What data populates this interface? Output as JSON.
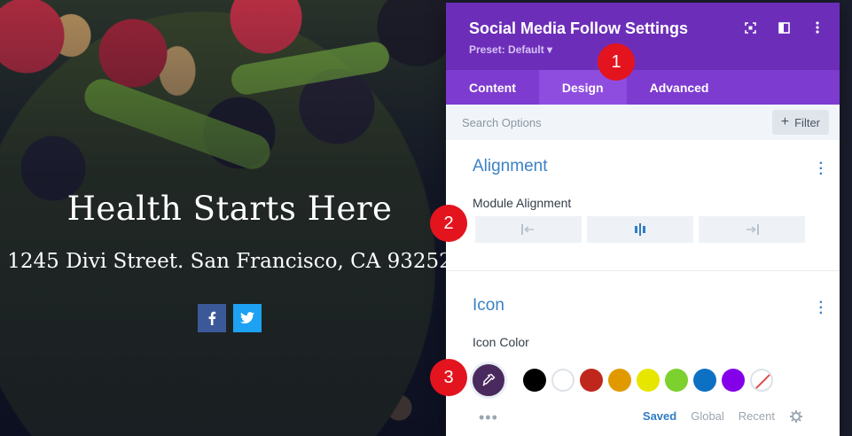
{
  "preview": {
    "title": "Health Starts Here",
    "subtitle": "1245 Divi Street. San Francisco, CA 93252",
    "social": [
      {
        "network": "facebook",
        "icon": "facebook-icon",
        "color": "#3b5998"
      },
      {
        "network": "twitter",
        "icon": "twitter-icon",
        "color": "#1da1f2"
      }
    ]
  },
  "panel": {
    "title": "Social Media Follow Settings",
    "preset": "Preset: Default",
    "header_icons": [
      "expand-icon",
      "split-view-icon",
      "more-options-icon"
    ],
    "tabs": [
      {
        "label": "Content",
        "active": false
      },
      {
        "label": "Design",
        "active": true
      },
      {
        "label": "Advanced",
        "active": false
      }
    ],
    "search": {
      "placeholder": "Search Options",
      "filter_label": "Filter"
    },
    "alignment": {
      "title": "Alignment",
      "field_label": "Module Alignment",
      "options": [
        "align-left-icon",
        "align-center-icon",
        "align-right-icon"
      ],
      "selected": "center"
    },
    "icon_section": {
      "title": "Icon",
      "field_label": "Icon Color",
      "picker_color": "#4a2a5e",
      "swatches": [
        "#000000",
        "#ffffff",
        "#c0271c",
        "#e09a00",
        "#e6e600",
        "#7cd12e",
        "#0c71c3",
        "#8300e9",
        "none"
      ],
      "palette_tabs": [
        {
          "label": "Saved",
          "active": true
        },
        {
          "label": "Global",
          "active": false
        },
        {
          "label": "Recent",
          "active": false
        }
      ]
    }
  },
  "badges": [
    "1",
    "2",
    "3"
  ]
}
